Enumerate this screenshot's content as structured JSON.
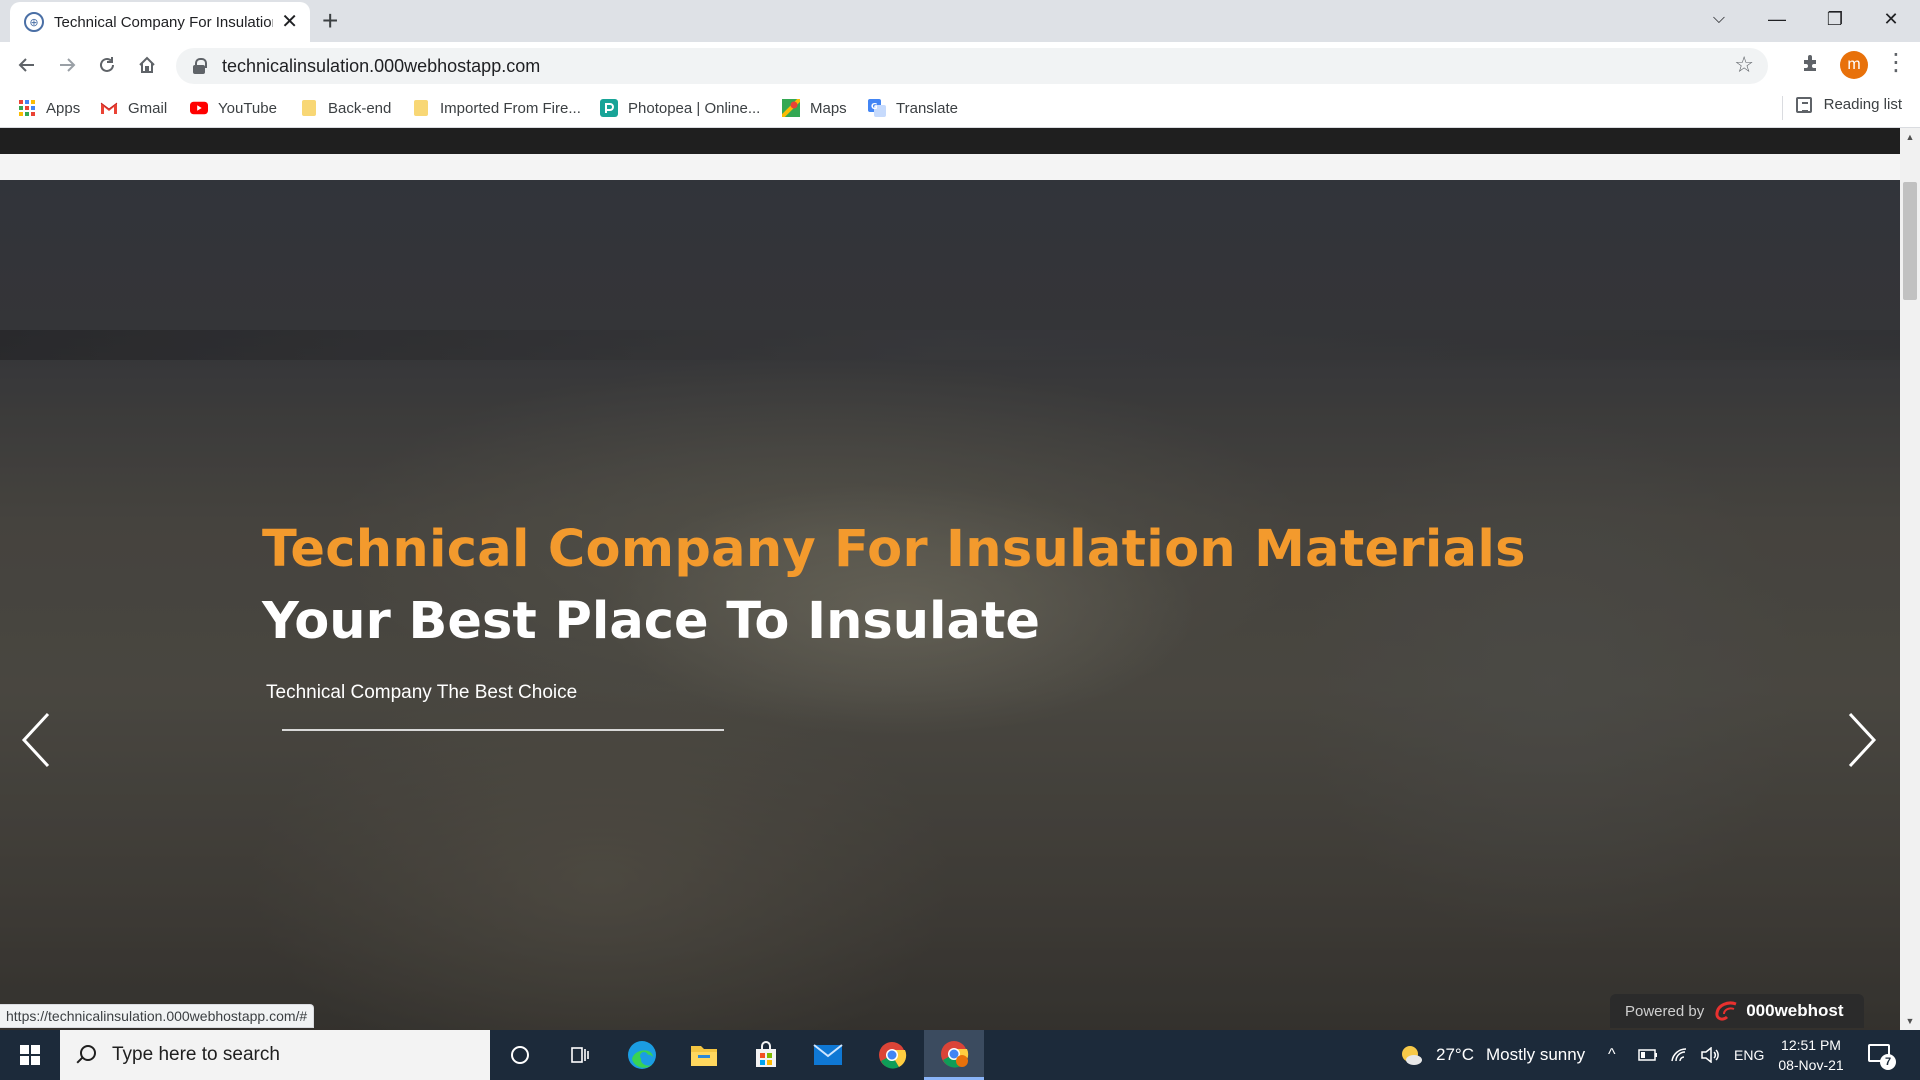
{
  "browser": {
    "tab": {
      "title": "Technical Company For Insulation Materials",
      "favicon": "globe-favicon",
      "close_label": "✕"
    },
    "new_tab_label": "+",
    "window_controls": {
      "tab_search": "⌵",
      "minimize": "—",
      "restore": "❐",
      "close": "✕"
    },
    "address_bar": {
      "url": "technicalinsulation.000webhostapp.com"
    },
    "profile_initial": "m",
    "bookmarks": [
      {
        "label": "Apps",
        "icon": "apps-grid-icon"
      },
      {
        "label": "Gmail",
        "icon": "gmail-icon"
      },
      {
        "label": "YouTube",
        "icon": "youtube-icon"
      },
      {
        "label": "Back-end",
        "icon": "folder-icon"
      },
      {
        "label": "Imported From Fire...",
        "icon": "folder-icon"
      },
      {
        "label": "Photopea | Online...",
        "icon": "photopea-icon"
      },
      {
        "label": "Maps",
        "icon": "maps-icon"
      },
      {
        "label": "Translate",
        "icon": "translate-icon"
      }
    ],
    "reading_list": "Reading list",
    "status_url": "https://technicalinsulation.000webhostapp.com/#"
  },
  "page": {
    "hero": {
      "title": "Technical Company For Insulation Materials",
      "subtitle": "Your Best Place To Insulate",
      "tagline": "Technical Company The Best Choice"
    },
    "powered_by": {
      "prefix": "Powered by",
      "brand": "000webhost"
    },
    "colors": {
      "accent": "#f39a2d",
      "topbar": "#1f1f1f"
    }
  },
  "taskbar": {
    "search_placeholder": "Type here to search",
    "apps": [
      "cortana-icon",
      "task-view-icon",
      "edge-icon",
      "file-explorer-icon",
      "store-icon",
      "mail-icon",
      "chrome-icon",
      "chrome-profile-icon"
    ],
    "weather": {
      "temp": "27°C",
      "condition": "Mostly sunny"
    },
    "language": "ENG",
    "time": "12:51 PM",
    "date": "08-Nov-21",
    "notification_count": "7"
  }
}
